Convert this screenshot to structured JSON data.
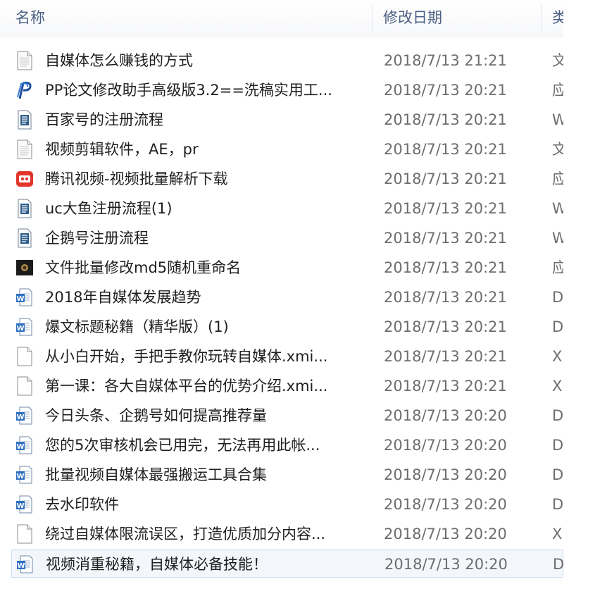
{
  "columns": {
    "name": "名称",
    "date": "修改日期",
    "type": "类"
  },
  "files": [
    {
      "icon": "text-file-icon",
      "name": "自媒体怎么赚钱的方式",
      "date": "2018/7/13 21:21",
      "type": "文"
    },
    {
      "icon": "pp-app-icon",
      "name": "PP论文修改助手高级版3.2==洗稿实用工...",
      "date": "2018/7/13 20:21",
      "type": "应"
    },
    {
      "icon": "wps-doc-icon",
      "name": "百家号的注册流程",
      "date": "2018/7/13 20:21",
      "type": "W"
    },
    {
      "icon": "text-file-icon",
      "name": "视频剪辑软件，AE，pr",
      "date": "2018/7/13 20:21",
      "type": "文"
    },
    {
      "icon": "video-app-icon",
      "name": "腾讯视频-视频批量解析下载",
      "date": "2018/7/13 20:21",
      "type": "应"
    },
    {
      "icon": "wps-doc-icon",
      "name": "uc大鱼注册流程(1)",
      "date": "2018/7/13 20:21",
      "type": "W"
    },
    {
      "icon": "wps-doc-icon",
      "name": "企鹅号注册流程",
      "date": "2018/7/13 20:21",
      "type": "W"
    },
    {
      "icon": "dark-app-icon",
      "name": "文件批量修改md5随机重命名",
      "date": "2018/7/13 20:21",
      "type": "应"
    },
    {
      "icon": "word-doc-icon",
      "name": "2018年自媒体发展趋势",
      "date": "2018/7/13 20:21",
      "type": "D"
    },
    {
      "icon": "word-doc-icon",
      "name": "爆文标题秘籍（精华版）(1)",
      "date": "2018/7/13 20:21",
      "type": "D"
    },
    {
      "icon": "blank-file-icon",
      "name": "从小白开始，手把手教你玩转自媒体.xmi...",
      "date": "2018/7/13 20:21",
      "type": "X"
    },
    {
      "icon": "blank-file-icon",
      "name": "第一课：各大自媒体平台的优势介绍.xmi...",
      "date": "2018/7/13 20:21",
      "type": "X"
    },
    {
      "icon": "word-doc-icon",
      "name": "今日头条、企鹅号如何提高推荐量",
      "date": "2018/7/13 20:20",
      "type": "D"
    },
    {
      "icon": "word-doc-icon",
      "name": "您的5次审核机会已用完，无法再用此帐...",
      "date": "2018/7/13 20:20",
      "type": "D"
    },
    {
      "icon": "word-doc-icon",
      "name": "批量视频自媒体最强搬运工具合集",
      "date": "2018/7/13 20:20",
      "type": "D"
    },
    {
      "icon": "word-doc-icon",
      "name": "去水印软件",
      "date": "2018/7/13 20:20",
      "type": "D"
    },
    {
      "icon": "blank-file-icon",
      "name": "绕过自媒体限流误区，打造优质加分内容...",
      "date": "2018/7/13 20:20",
      "type": "X"
    },
    {
      "icon": "word-doc-icon",
      "name": "视频消重秘籍，自媒体必备技能！",
      "date": "2018/7/13 20:20",
      "type": "D"
    }
  ]
}
